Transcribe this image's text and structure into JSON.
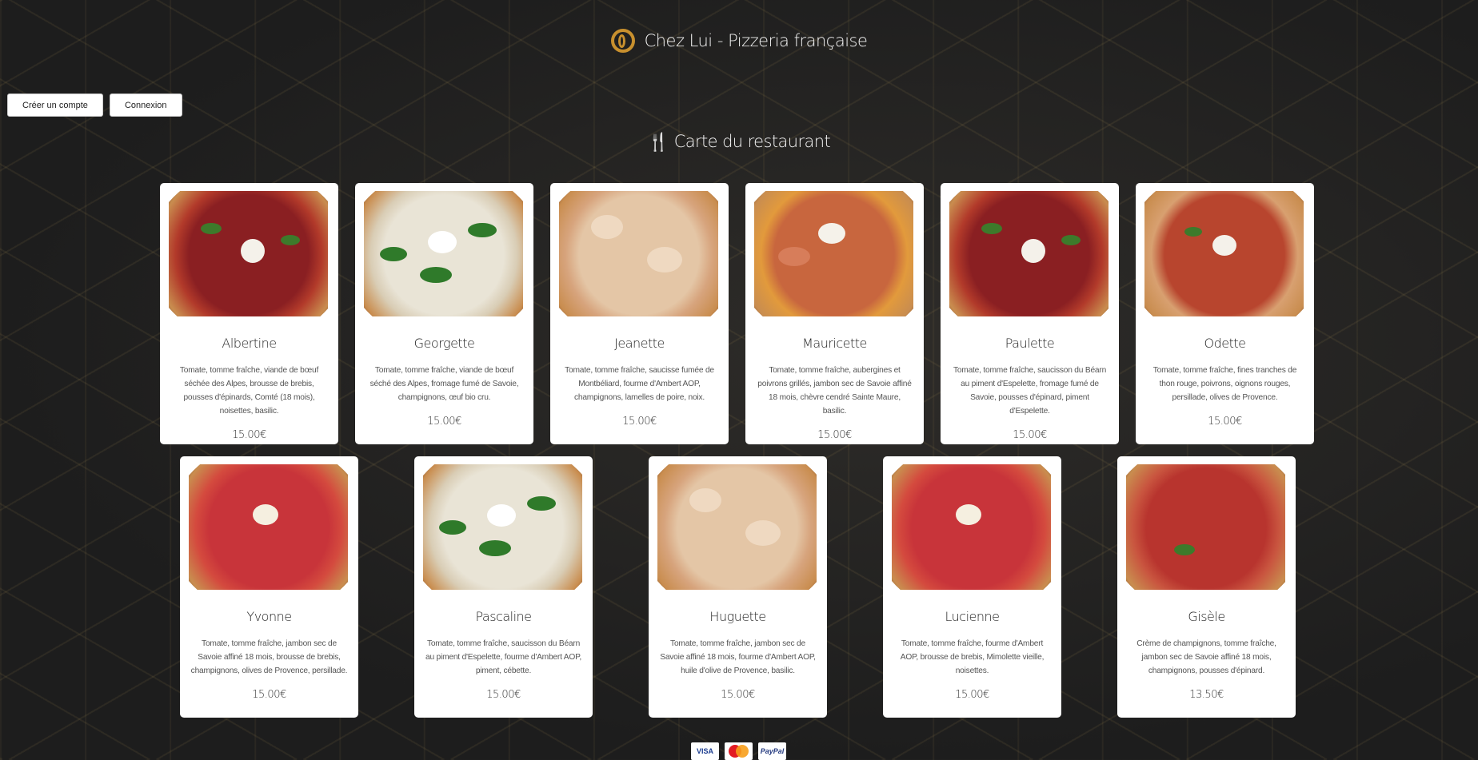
{
  "site": {
    "title": "Chez Lui - Pizzeria française"
  },
  "auth": {
    "register_label": "Créer un compte",
    "login_label": "Connexion"
  },
  "menu": {
    "title": "Carte du restaurant",
    "pizzas": [
      {
        "name": "Albertine",
        "desc": "Tomate, tomme fraîche, viande de bœuf séchée des Alpes, brousse de brebis, pousses d'épinards, Comté (18 mois), noisettes, basilic.",
        "price": "15.00€"
      },
      {
        "name": "Georgette",
        "desc": "Tomate, tomme fraîche, viande de bœuf séché des Alpes, fromage fumé de Savoie, champignons, œuf bio cru.",
        "price": "15.00€"
      },
      {
        "name": "Jeanette",
        "desc": "Tomate, tomme fraîche, saucisse fumée de Montbéliard, fourme d'Ambert AOP, champignons, lamelles de poire, noix.",
        "price": "15.00€"
      },
      {
        "name": "Mauricette",
        "desc": "Tomate, tomme fraîche, aubergines et poivrons grillés, jambon sec de Savoie affiné 18 mois, chèvre cendré Sainte Maure, basilic.",
        "price": "15.00€"
      },
      {
        "name": "Paulette",
        "desc": "Tomate, tomme fraîche, saucisson du Béarn au piment d'Espelette, fromage fumé de Savoie, pousses d'épinard, piment d'Espelette.",
        "price": "15.00€"
      },
      {
        "name": "Odette",
        "desc": "Tomate, tomme fraîche, fines tranches de thon rouge, poivrons, oignons rouges, persillade, olives de Provence.",
        "price": "15.00€"
      },
      {
        "name": "Yvonne",
        "desc": "Tomate, tomme fraîche, jambon sec de Savoie affiné 18 mois, brousse de brebis, champignons, olives de Provence, persillade.",
        "price": "15.00€"
      },
      {
        "name": "Pascaline",
        "desc": "Tomate, tomme fraîche, saucisson du Béarn au piment d'Espelette, fourme d'Ambert AOP, piment, cébette.",
        "price": "15.00€"
      },
      {
        "name": "Huguette",
        "desc": "Tomate, tomme fraîche, jambon sec de Savoie affiné 18 mois, fourme d'Ambert AOP, huile d'olive de Provence, basilic.",
        "price": "15.00€"
      },
      {
        "name": "Lucienne",
        "desc": "Tomate, tomme fraîche, fourme d'Ambert AOP, brousse de brebis, Mimolette vieille, noisettes.",
        "price": "15.00€"
      },
      {
        "name": "Gisèle",
        "desc": "Crème de champignons, tomme fraîche, jambon sec de Savoie affiné 18 mois, champignons, pousses d'épinard.",
        "price": "13.50€"
      }
    ]
  },
  "payments": {
    "visa": "VISA",
    "mastercard": "MasterCard",
    "paypal": "PayPal"
  },
  "icons": {
    "logo": "brand-logo-icon",
    "menu": "fork-knife-icon"
  },
  "colors": {
    "accent": "#c8902e",
    "background": "#1f1f1f",
    "card": "#ffffff"
  }
}
